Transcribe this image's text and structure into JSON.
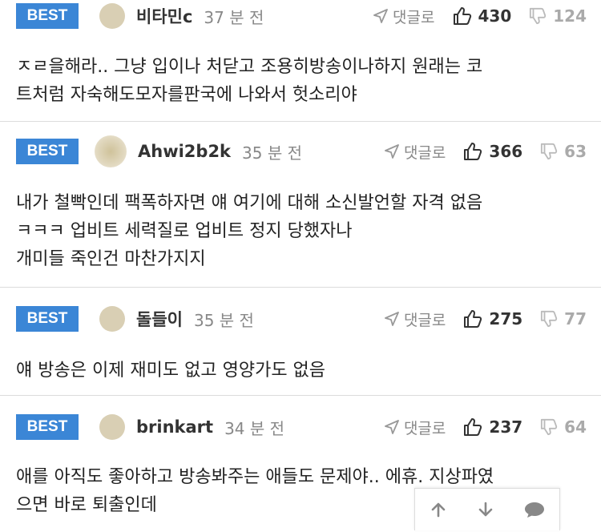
{
  "best_label": "BEST",
  "reply_label": "댓글로",
  "comments": [
    {
      "nick": "비타민c",
      "time": "37 분 전",
      "up": "430",
      "down": "124",
      "lines": [
        "ㅈㄹ을해라.. 그냥 입이나 처닫고 조용히방송이나하지 원래는 코",
        "트처럼 자숙해도모자를판국에 나와서 헛소리야"
      ]
    },
    {
      "nick": "Ahwi2b2k",
      "time": "35 분 전",
      "up": "366",
      "down": "63",
      "lines": [
        "내가 철빡인데 팩폭하자면 얘 여기에 대해 소신발언할 자격 없음",
        "ㅋㅋㅋ 업비트 세력질로 업비트 정지 당했자나",
        "개미들 죽인건 마찬가지지"
      ]
    },
    {
      "nick": "돌들이",
      "time": "35 분 전",
      "up": "275",
      "down": "77",
      "lines": [
        "얘 방송은 이제 재미도 없고 영양가도 없음"
      ]
    },
    {
      "nick": "brinkart",
      "time": "34 분 전",
      "up": "237",
      "down": "64",
      "lines": [
        "애를 아직도 좋아하고 방송봐주는 애들도 문제야.. 에휴. 지상파였",
        "으면 바로 퇴출인데"
      ]
    }
  ],
  "floatbar": {
    "icons": [
      "arrow-up-icon",
      "arrow-down-icon",
      "chat-icon"
    ]
  }
}
